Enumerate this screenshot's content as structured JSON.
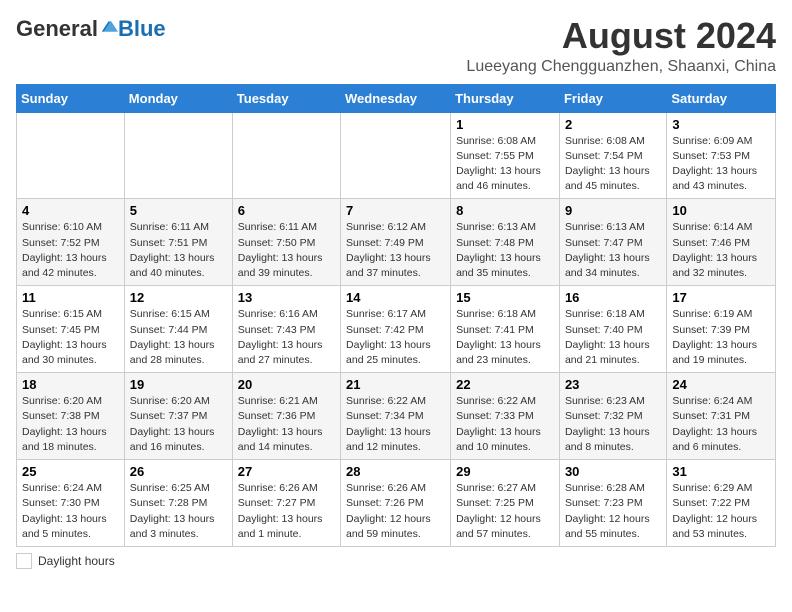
{
  "header": {
    "logo_general": "General",
    "logo_blue": "Blue",
    "main_title": "August 2024",
    "subtitle": "Lueeyang Chengguanzhen, Shaanxi, China"
  },
  "days_of_week": [
    "Sunday",
    "Monday",
    "Tuesday",
    "Wednesday",
    "Thursday",
    "Friday",
    "Saturday"
  ],
  "weeks": [
    [
      {
        "day": "",
        "info": ""
      },
      {
        "day": "",
        "info": ""
      },
      {
        "day": "",
        "info": ""
      },
      {
        "day": "",
        "info": ""
      },
      {
        "day": "1",
        "info": "Sunrise: 6:08 AM\nSunset: 7:55 PM\nDaylight: 13 hours and 46 minutes."
      },
      {
        "day": "2",
        "info": "Sunrise: 6:08 AM\nSunset: 7:54 PM\nDaylight: 13 hours and 45 minutes."
      },
      {
        "day": "3",
        "info": "Sunrise: 6:09 AM\nSunset: 7:53 PM\nDaylight: 13 hours and 43 minutes."
      }
    ],
    [
      {
        "day": "4",
        "info": "Sunrise: 6:10 AM\nSunset: 7:52 PM\nDaylight: 13 hours and 42 minutes."
      },
      {
        "day": "5",
        "info": "Sunrise: 6:11 AM\nSunset: 7:51 PM\nDaylight: 13 hours and 40 minutes."
      },
      {
        "day": "6",
        "info": "Sunrise: 6:11 AM\nSunset: 7:50 PM\nDaylight: 13 hours and 39 minutes."
      },
      {
        "day": "7",
        "info": "Sunrise: 6:12 AM\nSunset: 7:49 PM\nDaylight: 13 hours and 37 minutes."
      },
      {
        "day": "8",
        "info": "Sunrise: 6:13 AM\nSunset: 7:48 PM\nDaylight: 13 hours and 35 minutes."
      },
      {
        "day": "9",
        "info": "Sunrise: 6:13 AM\nSunset: 7:47 PM\nDaylight: 13 hours and 34 minutes."
      },
      {
        "day": "10",
        "info": "Sunrise: 6:14 AM\nSunset: 7:46 PM\nDaylight: 13 hours and 32 minutes."
      }
    ],
    [
      {
        "day": "11",
        "info": "Sunrise: 6:15 AM\nSunset: 7:45 PM\nDaylight: 13 hours and 30 minutes."
      },
      {
        "day": "12",
        "info": "Sunrise: 6:15 AM\nSunset: 7:44 PM\nDaylight: 13 hours and 28 minutes."
      },
      {
        "day": "13",
        "info": "Sunrise: 6:16 AM\nSunset: 7:43 PM\nDaylight: 13 hours and 27 minutes."
      },
      {
        "day": "14",
        "info": "Sunrise: 6:17 AM\nSunset: 7:42 PM\nDaylight: 13 hours and 25 minutes."
      },
      {
        "day": "15",
        "info": "Sunrise: 6:18 AM\nSunset: 7:41 PM\nDaylight: 13 hours and 23 minutes."
      },
      {
        "day": "16",
        "info": "Sunrise: 6:18 AM\nSunset: 7:40 PM\nDaylight: 13 hours and 21 minutes."
      },
      {
        "day": "17",
        "info": "Sunrise: 6:19 AM\nSunset: 7:39 PM\nDaylight: 13 hours and 19 minutes."
      }
    ],
    [
      {
        "day": "18",
        "info": "Sunrise: 6:20 AM\nSunset: 7:38 PM\nDaylight: 13 hours and 18 minutes."
      },
      {
        "day": "19",
        "info": "Sunrise: 6:20 AM\nSunset: 7:37 PM\nDaylight: 13 hours and 16 minutes."
      },
      {
        "day": "20",
        "info": "Sunrise: 6:21 AM\nSunset: 7:36 PM\nDaylight: 13 hours and 14 minutes."
      },
      {
        "day": "21",
        "info": "Sunrise: 6:22 AM\nSunset: 7:34 PM\nDaylight: 13 hours and 12 minutes."
      },
      {
        "day": "22",
        "info": "Sunrise: 6:22 AM\nSunset: 7:33 PM\nDaylight: 13 hours and 10 minutes."
      },
      {
        "day": "23",
        "info": "Sunrise: 6:23 AM\nSunset: 7:32 PM\nDaylight: 13 hours and 8 minutes."
      },
      {
        "day": "24",
        "info": "Sunrise: 6:24 AM\nSunset: 7:31 PM\nDaylight: 13 hours and 6 minutes."
      }
    ],
    [
      {
        "day": "25",
        "info": "Sunrise: 6:24 AM\nSunset: 7:30 PM\nDaylight: 13 hours and 5 minutes."
      },
      {
        "day": "26",
        "info": "Sunrise: 6:25 AM\nSunset: 7:28 PM\nDaylight: 13 hours and 3 minutes."
      },
      {
        "day": "27",
        "info": "Sunrise: 6:26 AM\nSunset: 7:27 PM\nDaylight: 13 hours and 1 minute."
      },
      {
        "day": "28",
        "info": "Sunrise: 6:26 AM\nSunset: 7:26 PM\nDaylight: 12 hours and 59 minutes."
      },
      {
        "day": "29",
        "info": "Sunrise: 6:27 AM\nSunset: 7:25 PM\nDaylight: 12 hours and 57 minutes."
      },
      {
        "day": "30",
        "info": "Sunrise: 6:28 AM\nSunset: 7:23 PM\nDaylight: 12 hours and 55 minutes."
      },
      {
        "day": "31",
        "info": "Sunrise: 6:29 AM\nSunset: 7:22 PM\nDaylight: 12 hours and 53 minutes."
      }
    ]
  ],
  "footer": {
    "daylight_label": "Daylight hours"
  }
}
